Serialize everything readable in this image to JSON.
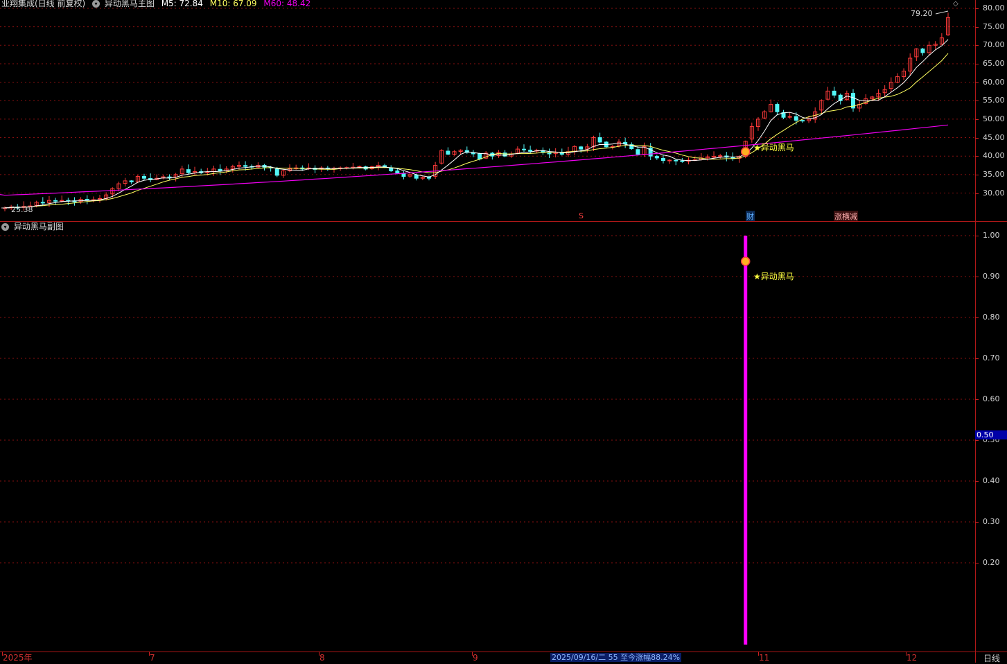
{
  "main_header": {
    "stock": "业翔集成(日线 前复权)",
    "indicator": "异动黑马主图",
    "ma5_label": "M5: 72.84",
    "ma10_label": "M10: 67.09",
    "ma60_label": "M60: 48.42"
  },
  "sub_header": {
    "indicator": "异动黑马副图"
  },
  "annotations": {
    "high_label": "79.20",
    "low_label": "25.38",
    "signal_label": "★异动黑马",
    "sub_signal_label": "★异动黑马",
    "event_s": "S",
    "event_cai": "财",
    "event_zt": "涨横减"
  },
  "x_axis": {
    "labels": [
      "2025年",
      "7",
      "8",
      "9",
      "11",
      "12"
    ],
    "crosshair_info": "2025/09/16/二 55 至今涨幅88.24%",
    "period": "日线"
  },
  "colors": {
    "up": "#ff3a3a",
    "down": "#52f6f6",
    "ma5": "#ffffff",
    "ma10": "#ffff60",
    "ma60": "#ee00ee",
    "grid": "#8a1010",
    "signal_bar": "#ff00ff"
  },
  "chart_data": [
    {
      "type": "candlestick",
      "title": "异动黑马主图",
      "y_axis": {
        "ticks": [
          "80.00",
          "75.00",
          "70.00",
          "65.00",
          "60.00",
          "55.00",
          "50.00",
          "45.00",
          "40.00",
          "35.00",
          "30.00"
        ],
        "ylim": [
          25,
          81
        ]
      },
      "ma_series": [
        {
          "name": "M5",
          "last": 72.84
        },
        {
          "name": "M10",
          "last": 67.09
        },
        {
          "name": "M60",
          "last": 48.42
        }
      ],
      "closes": [
        26.0,
        26.2,
        26.1,
        26.4,
        26.5,
        27.5,
        27.3,
        28.0,
        27.8,
        28.0,
        27.9,
        27.6,
        28.3,
        28.1,
        28.2,
        28.5,
        29.5,
        31.2,
        32.5,
        33.3,
        33.0,
        34.5,
        34.0,
        33.6,
        34.0,
        34.4,
        34.2,
        35.0,
        36.5,
        35.5,
        35.8,
        35.5,
        35.7,
        36.5,
        36.0,
        36.5,
        37.2,
        37.5,
        37.2,
        37.0,
        37.5,
        37.0,
        36.8,
        34.8,
        36.0,
        36.6,
        36.8,
        36.5,
        36.8,
        36.4,
        36.8,
        36.6,
        36.7,
        36.8,
        36.9,
        37.0,
        37.2,
        36.5,
        37.1,
        37.5,
        37.0,
        36.0,
        35.4,
        34.5,
        35.0,
        34.0,
        34.3,
        34.0,
        37.5,
        41.5,
        40.5,
        41.2,
        41.6,
        41.0,
        40.6,
        39.2,
        40.8,
        40.0,
        41.0,
        40.0,
        40.6,
        41.9,
        41.7,
        41.3,
        41.6,
        41.0,
        40.6,
        41.0,
        40.5,
        41.2,
        42.6,
        41.9,
        42.5,
        45.0,
        43.8,
        42.5,
        42.6,
        43.8,
        43.3,
        42.0,
        40.5,
        42.6,
        40.0,
        39.5,
        38.8,
        38.9,
        38.7,
        38.6,
        38.9,
        39.0,
        39.5,
        39.8,
        39.9,
        40.1,
        39.7,
        39.3,
        39.9,
        44.0,
        48.0,
        50.0,
        52.0,
        54.0,
        52.0,
        50.5,
        50.7,
        49.7,
        49.5,
        50.0,
        52.0,
        55.0,
        57.6,
        56.5,
        55.0,
        57.0,
        53.0,
        54.0,
        55.5,
        56.0,
        57.0,
        58.0,
        60.0,
        61.5,
        63.0,
        66.5,
        69.0,
        68.0,
        70.0,
        70.3,
        72.0,
        77.5
      ],
      "ma60_range": [
        29.4,
        48.42
      ],
      "signal_date": "2025/09/16",
      "annotations": [
        "79.20",
        "25.38",
        "★异动黑马",
        "S",
        "财",
        "涨横减"
      ]
    },
    {
      "type": "bar",
      "title": "异动黑马副图",
      "y_axis": {
        "ticks": [
          "1.00",
          "0.90",
          "0.80",
          "0.70",
          "0.60",
          "0.50",
          "0.40",
          "0.30",
          "0.20"
        ],
        "ylim": [
          0.0,
          1.03
        ]
      },
      "current_value_label": "0.50",
      "signal": {
        "x": "2025/09/16",
        "value": 1.0,
        "marker": "★异动黑马"
      }
    }
  ]
}
